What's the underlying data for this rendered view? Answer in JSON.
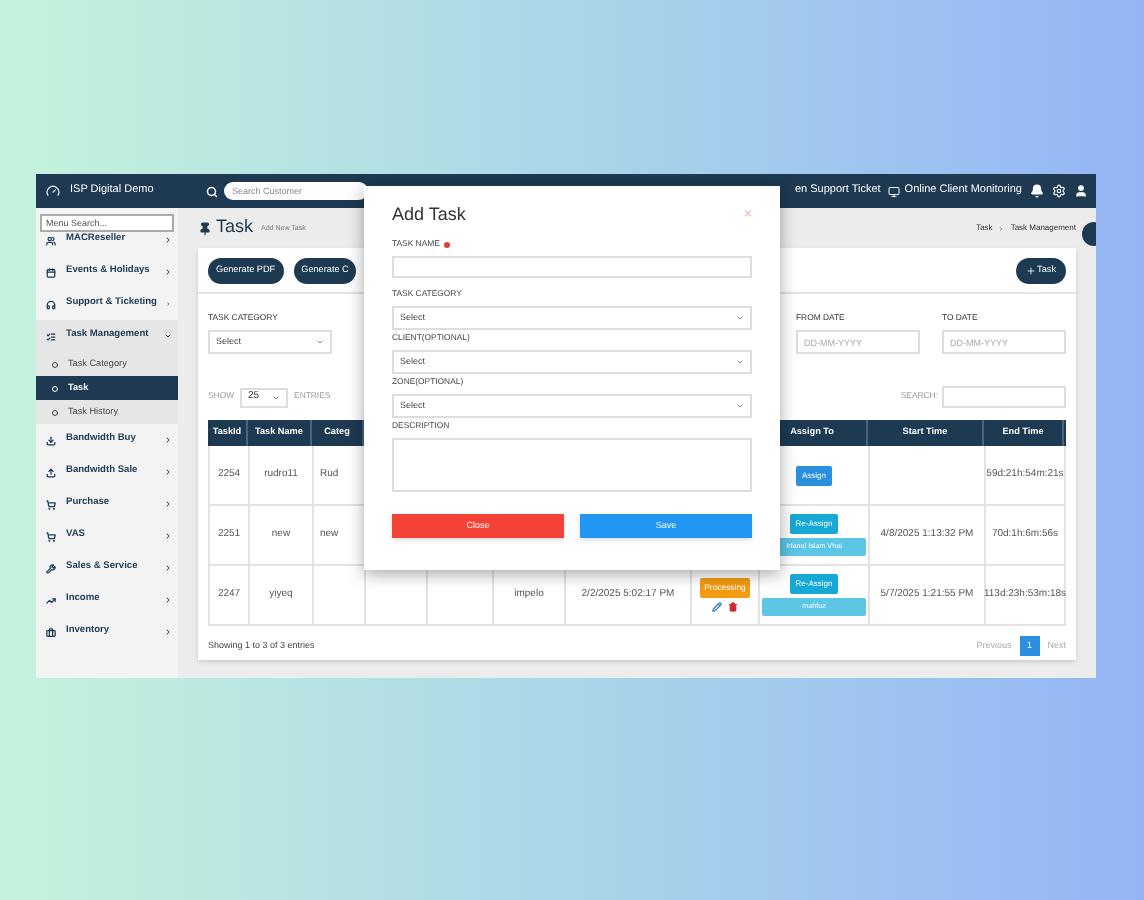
{
  "topbar": {
    "brand": "ISP Digital Demo",
    "search_placeholder": "Search Customer",
    "links": [
      "en Support Ticket",
      "Online Client Monitoring"
    ]
  },
  "sidebar": {
    "search_placeholder": "Menu Search...",
    "items": [
      {
        "label": "MACReseller",
        "expanded": false
      },
      {
        "label": "Events & Holidays",
        "expanded": false
      },
      {
        "label": "Support & Ticketing",
        "expanded": false
      },
      {
        "label": "Task Management",
        "expanded": true,
        "children": [
          {
            "label": "Task Category",
            "selected": false
          },
          {
            "label": "Task",
            "selected": true
          },
          {
            "label": "Task History",
            "selected": false
          }
        ]
      },
      {
        "label": "Bandwidth Buy",
        "expanded": false
      },
      {
        "label": "Bandwidth Sale",
        "expanded": false
      },
      {
        "label": "Purchase",
        "expanded": false
      },
      {
        "label": "VAS",
        "expanded": false
      },
      {
        "label": "Sales & Service",
        "expanded": false
      },
      {
        "label": "Income",
        "expanded": false
      },
      {
        "label": "Inventory",
        "expanded": false
      }
    ]
  },
  "page": {
    "title": "Task",
    "subtitle": "Add New Task",
    "breadcrumb": [
      "Task",
      "Task Management"
    ]
  },
  "toolbar": {
    "buttons": [
      "Generate PDF",
      "Generate C"
    ],
    "add_button": "Task"
  },
  "filters": [
    {
      "label": "TASK CATEGORY",
      "kind": "select",
      "value": "Select"
    },
    {
      "label": "FROM DATE",
      "kind": "date",
      "placeholder": "DD-MM-YYYY"
    },
    {
      "label": "TO DATE",
      "kind": "date",
      "placeholder": "DD-MM-YYYY"
    }
  ],
  "entries": {
    "show_label": "SHOW",
    "value": "25",
    "suffix": "ENTRIES",
    "search_label": "SEARCH:"
  },
  "table": {
    "columns": [
      "TaskId",
      "Task Name",
      "Categ",
      "Assign To",
      "Start Time",
      "End Time"
    ],
    "rows": [
      {
        "task_id": "2254",
        "task_name": "rudro11",
        "category": "Rud",
        "assign": {
          "kind": "assign",
          "label": "Assign"
        },
        "end_time": "59d:21h:54m:21s"
      },
      {
        "task_id": "2251",
        "task_name": "new",
        "category": "new",
        "assign": {
          "kind": "reassign",
          "label": "Re-Assign",
          "assignee": "Irfanul Islam Vhai"
        },
        "start_time": "4/8/2025 1:13:32 PM",
        "end_time": "70d:1h:6m:56s"
      },
      {
        "task_id": "2247",
        "task_name": "yiyeq",
        "column_6": "impelo",
        "column_7": "2/2/2025 5:02:17 PM",
        "status": "Processing",
        "actions": true,
        "assign": {
          "kind": "reassign",
          "label": "Re-Assign",
          "assignee": "mahfuz"
        },
        "start_time": "5/7/2025 1:21:55 PM",
        "end_time": "113d:23h:53m:18s"
      }
    ]
  },
  "footer": {
    "info": "Showing 1 to 3 of 3 entries",
    "pages": [
      {
        "label": "Previous",
        "kind": "nav"
      },
      {
        "label": "1",
        "kind": "page",
        "selected": true
      },
      {
        "label": "Next",
        "kind": "nav"
      }
    ]
  },
  "modal": {
    "title": "Add Task",
    "close": "×",
    "fields": [
      {
        "label": "TASK NAME",
        "required": true,
        "kind": "text"
      },
      {
        "label": "TASK CATEGORY",
        "required": false,
        "kind": "select",
        "value": "Select"
      },
      {
        "label": "CLIENT(OPTIONAL)",
        "required": false,
        "kind": "select",
        "value": "Select"
      },
      {
        "label": "ZONE(OPTIONAL)",
        "required": false,
        "kind": "select",
        "value": "Select"
      },
      {
        "label": "DESCRIPTION",
        "required": false,
        "kind": "textarea"
      }
    ],
    "buttons": [
      {
        "label": "Close",
        "kind": "danger"
      },
      {
        "label": "Save",
        "kind": "primary"
      }
    ]
  }
}
